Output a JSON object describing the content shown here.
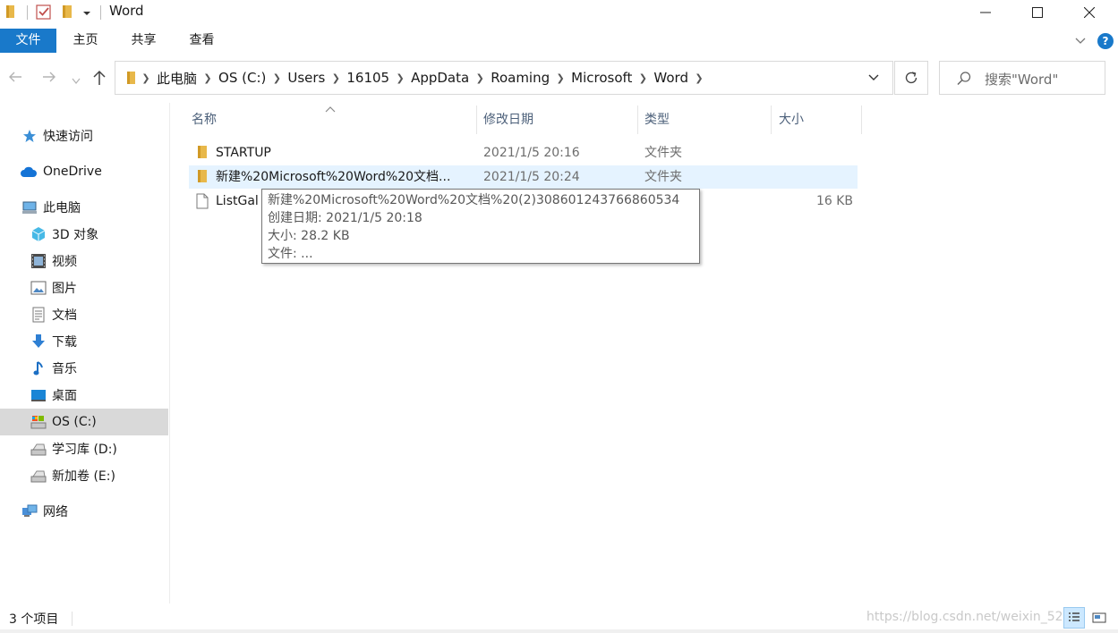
{
  "window": {
    "title": "Word",
    "controls": {
      "minimize_icon": "minimize-icon",
      "maximize_icon": "maximize-icon",
      "close_icon": "close-icon"
    }
  },
  "ribbon": {
    "tabs": [
      {
        "label": "文件",
        "active": true
      },
      {
        "label": "主页",
        "active": false
      },
      {
        "label": "共享",
        "active": false
      },
      {
        "label": "查看",
        "active": false
      }
    ],
    "help": "?"
  },
  "address": {
    "breadcrumbs": [
      "此电脑",
      "OS (C:)",
      "Users",
      "16105",
      "AppData",
      "Roaming",
      "Microsoft",
      "Word"
    ]
  },
  "search": {
    "placeholder": "搜索\"Word\""
  },
  "sidebar": {
    "items": [
      {
        "label": "快速访问",
        "icon": "star-icon"
      },
      {
        "label": "OneDrive",
        "icon": "cloud-icon"
      },
      {
        "label": "此电脑",
        "icon": "computer-icon"
      },
      {
        "label": "3D 对象",
        "icon": "cube-icon"
      },
      {
        "label": "视频",
        "icon": "video-icon"
      },
      {
        "label": "图片",
        "icon": "picture-icon"
      },
      {
        "label": "文档",
        "icon": "document-icon"
      },
      {
        "label": "下载",
        "icon": "download-icon"
      },
      {
        "label": "音乐",
        "icon": "music-icon"
      },
      {
        "label": "桌面",
        "icon": "desktop-icon"
      },
      {
        "label": "OS (C:)",
        "icon": "drive-icon",
        "selected": true
      },
      {
        "label": "学习库 (D:)",
        "icon": "drive-icon"
      },
      {
        "label": "新加卷 (E:)",
        "icon": "drive-icon"
      },
      {
        "label": "网络",
        "icon": "network-icon"
      }
    ]
  },
  "columns": {
    "name": "名称",
    "modified": "修改日期",
    "type": "类型",
    "size": "大小"
  },
  "files": [
    {
      "name": "STARTUP",
      "modified": "2021/1/5 20:16",
      "type": "文件夹",
      "size": "",
      "icon": "folder-icon"
    },
    {
      "name": "新建%20Microsoft%20Word%20文档...",
      "modified": "2021/1/5 20:24",
      "type": "文件夹",
      "size": "",
      "icon": "folder-icon"
    },
    {
      "name": "ListGal",
      "modified": "",
      "type": "",
      "size": "16 KB",
      "icon": "file-icon"
    }
  ],
  "tooltip": {
    "line1": "新建%20Microsoft%20Word%20文档%20(2)308601243766860534",
    "line2": "创建日期: 2021/1/5 20:18",
    "line3": "大小: 28.2 KB",
    "line4": "文件: ..."
  },
  "status": {
    "count": "3 个项目",
    "watermark": "https://blog.csdn.net/weixin_52"
  },
  "colors": {
    "accent": "#1979ca",
    "hover_row": "#e5f3ff",
    "folder": "#e8b84a"
  }
}
